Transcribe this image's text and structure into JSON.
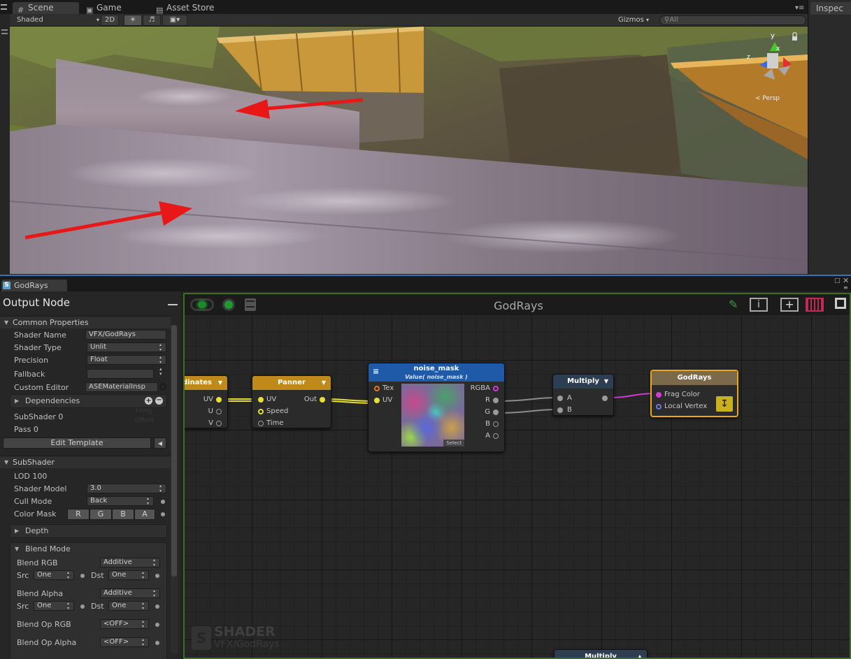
{
  "scene_window": {
    "tabs": [
      {
        "label": "Scene",
        "icon": "grid-icon"
      },
      {
        "label": "Game",
        "icon": "gamepad-icon"
      },
      {
        "label": "Asset Store",
        "icon": "store-icon"
      }
    ],
    "inspector_tab": "Inspec",
    "toolbar": {
      "shading_mode": "Shaded",
      "mode_2d": "2D",
      "gizmos_label": "Gizmos",
      "search_placeholder": "All"
    },
    "gizmo": {
      "y_label": "y",
      "x_label": "x",
      "z_label": "z",
      "view_label": "< Persp"
    }
  },
  "editor": {
    "tab_label": "GodRays",
    "canvas_title": "GodRays",
    "watermark": {
      "title": "SHADER",
      "subtitle": "VFX/GodRays"
    }
  },
  "props": {
    "title": "Output Node",
    "common_header": "Common Properties",
    "shader_name_label": "Shader Name",
    "shader_name_value": "VFX/GodRays",
    "shader_type_label": "Shader Type",
    "shader_type_value": "Unlit",
    "precision_label": "Precision",
    "precision_value": "Float",
    "fallback_label": "Fallback",
    "fallback_value": "",
    "custom_editor_label": "Custom Editor",
    "custom_editor_value": "ASEMaterialInsp",
    "dependencies_label": "Dependencies",
    "subshader_index": "SubShader 0",
    "pass_index": "Pass 0",
    "edit_template": "Edit Template",
    "subshader_header": "SubShader",
    "lod": "LOD 100",
    "shader_model_label": "Shader Model",
    "shader_model_value": "3.0",
    "cull_mode_label": "Cull Mode",
    "cull_mode_value": "Back",
    "color_mask_label": "Color Mask",
    "color_mask": [
      "R",
      "G",
      "B",
      "A"
    ],
    "depth_label": "Depth",
    "blend_mode_label": "Blend Mode",
    "blend_rgb_label": "Blend RGB",
    "blend_rgb_value": "Additive",
    "src_label": "Src",
    "dst_label": "Dst",
    "one": "One",
    "blend_alpha_label": "Blend Alpha",
    "blend_alpha_value": "Additive",
    "blend_op_rgb_label": "Blend Op RGB",
    "blend_op_rgb_value": "<OFF>",
    "blend_op_alpha_label": "Blend Op Alpha",
    "blend_op_alpha_value": "<OFF>",
    "ghost_tiling": "Tiling",
    "ghost_offset": "Offset"
  },
  "nodes": {
    "texcoord": {
      "title": "dinates",
      "ports_out": [
        "UV",
        "U",
        "V"
      ],
      "color": "#c08a1a"
    },
    "panner": {
      "title": "Panner",
      "ports_in": [
        "UV",
        "Speed",
        "Time"
      ],
      "port_out": "Out",
      "color": "#c08a1a"
    },
    "noise": {
      "title": "noise_mask",
      "subtitle": "Value( noise_mask )",
      "ports_in": [
        "Tex",
        "UV"
      ],
      "ports_out": [
        "RGBA",
        "R",
        "G",
        "B",
        "A"
      ],
      "select_label": "Select",
      "color": "#1f5aa8"
    },
    "multiply": {
      "title": "Multiply",
      "ports_in": [
        "A",
        "B"
      ],
      "color": "#2e3e52"
    },
    "godrays": {
      "title": "GodRays",
      "ports_in": [
        "Frag Color",
        "Local Vertex"
      ],
      "color": "#7a6a4a"
    },
    "multiply2": {
      "title": "Multiply"
    }
  }
}
